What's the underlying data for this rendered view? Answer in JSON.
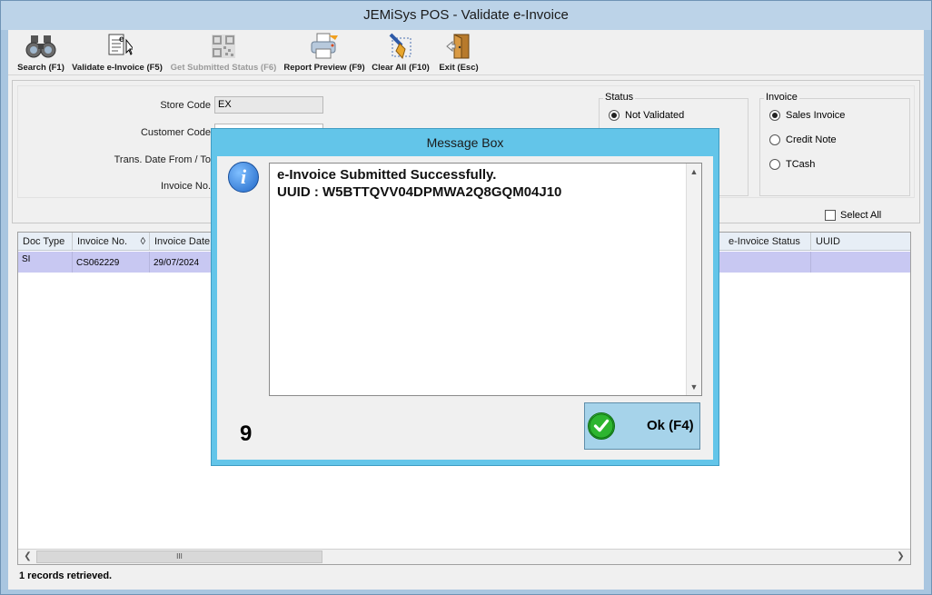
{
  "window": {
    "title": "JEMiSys POS - Validate e-Invoice"
  },
  "toolbar": {
    "search": "Search (F1)",
    "validate": "Validate e-Invoice (F5)",
    "get_status": "Get Submitted Status (F6)",
    "report": "Report Preview (F9)",
    "clear": "Clear All (F10)",
    "exit": "Exit (Esc)"
  },
  "filters": {
    "store_code_label": "Store Code",
    "store_code_value": "EX",
    "customer_code_label": "Customer Code",
    "trans_date_label": "Trans. Date From / To",
    "invoice_no_label": "Invoice No."
  },
  "status_group": {
    "title": "Status",
    "options": [
      "Not Validated"
    ],
    "selected": "Not Validated"
  },
  "invoice_group": {
    "title": "Invoice",
    "options": [
      "Sales Invoice",
      "Credit Note",
      "TCash"
    ],
    "selected": "Sales Invoice"
  },
  "select_all_label": "Select All",
  "grid": {
    "columns": [
      "Doc Type",
      "Invoice No.",
      "Invoice Date",
      "e-Invoice Status",
      "UUID"
    ],
    "sort_indicator": "◊",
    "rows": [
      {
        "doc_type": "SI",
        "invoice_no": "CS062229",
        "invoice_date": "29/07/2024",
        "status": "",
        "uuid": ""
      }
    ],
    "scroll_thumb": "III"
  },
  "status_bar": "1 records retrieved.",
  "modal": {
    "title": "Message Box",
    "line1": "e-Invoice Submitted Successfully.",
    "line2": "UUID : W5BTTQVV04DPMWA2Q8GQM04J10",
    "countdown": "9",
    "ok_label": "Ok (F4)"
  },
  "icons": {
    "search": "binoculars-icon",
    "validate": "document-icon",
    "get_status": "qr-code-icon",
    "report": "printer-icon",
    "clear": "brush-icon",
    "exit": "door-exit-icon",
    "info": "info-icon",
    "ok": "checkmark-icon"
  },
  "colors": {
    "modal_frame": "#63c5e9",
    "selected_row": "#c8c8f2",
    "ok_button": "#a6d3ea"
  }
}
